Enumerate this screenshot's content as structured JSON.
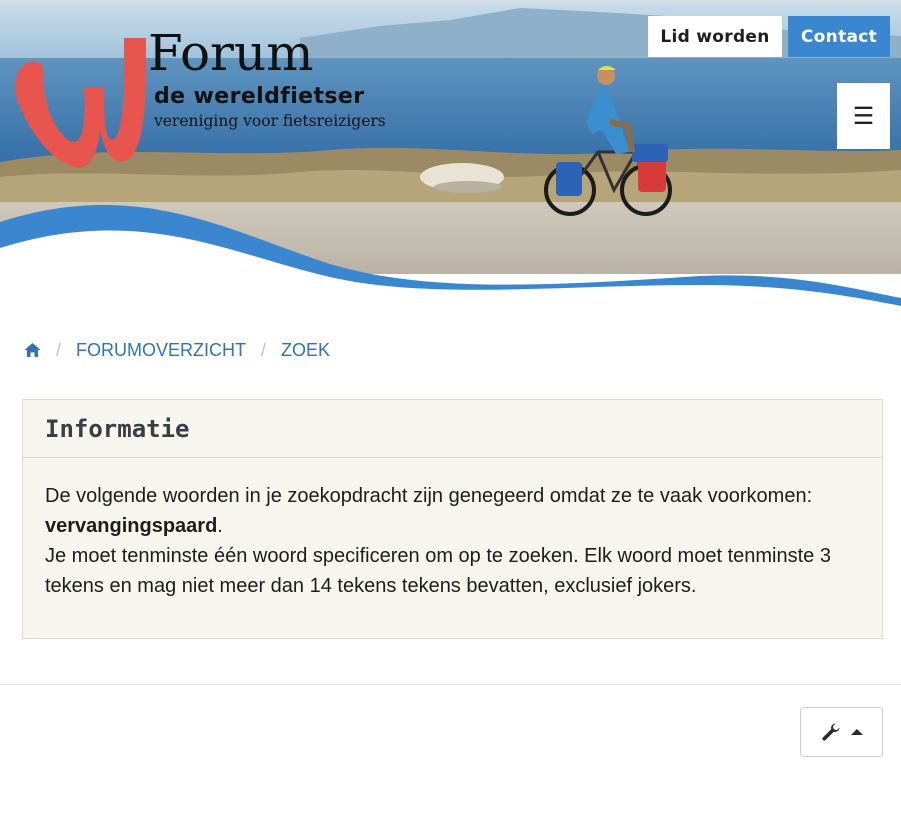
{
  "header": {
    "logo_title": "Forum",
    "logo_subtitle": "de wereldfietser",
    "logo_tagline": "vereniging voor fietsreizigers",
    "join_label": "Lid worden",
    "contact_label": "Contact",
    "menu_icon": "hamburger-icon",
    "colors": {
      "accent": "#3a86cf",
      "logo_red": "#e8554e",
      "wave": "#3a86cf"
    }
  },
  "breadcrumb": {
    "home_icon": "home-icon",
    "items": [
      "FORUMOVERZICHT",
      "ZOEK"
    ]
  },
  "panel": {
    "title": "Informatie",
    "line1": "De volgende woorden in je zoekopdracht zijn genegeerd omdat ze te vaak voorkomen:",
    "ignored_word": "vervangingspaard",
    "punct": ".",
    "line2": "Je moet tenminste één woord specificeren om op te zoeken. Elk woord moet tenminste 3 tekens en mag niet meer dan 14 tekens tekens bevatten, exclusief jokers."
  },
  "footer": {
    "tools_icon": "wrench-icon",
    "caret_icon": "caret-up-icon"
  }
}
